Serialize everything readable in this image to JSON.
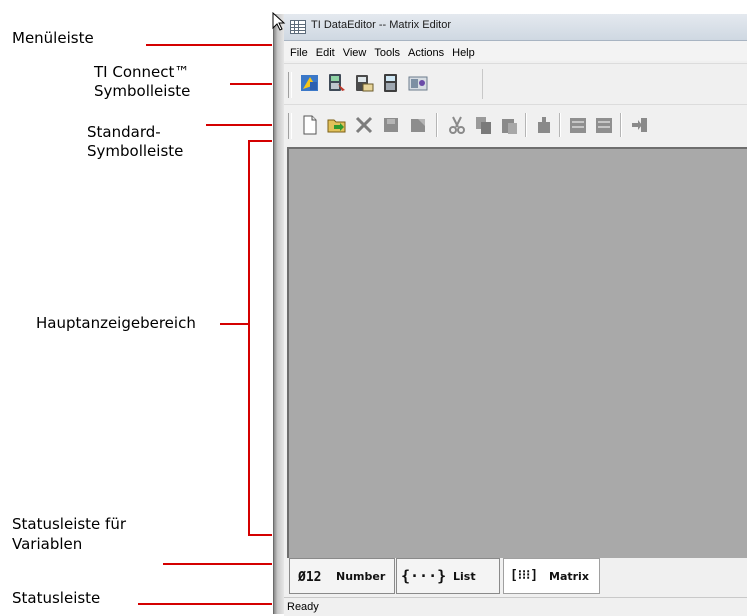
{
  "annotations": {
    "menubar": "Menüleiste",
    "ti_connect_line1": "TI Connect™",
    "ti_connect_line2": "Symbolleiste",
    "standard_line1": "Standard-",
    "standard_line2": "Symbolleiste",
    "main_area": "Hauptanzeigebereich",
    "var_status_line1": "Statusleiste für",
    "var_status_line2": "Variablen",
    "statusbar": "Statusleiste"
  },
  "window": {
    "title": "TI DataEditor -- Matrix Editor"
  },
  "menu": [
    "File",
    "Edit",
    "View",
    "Tools",
    "Actions",
    "Help"
  ],
  "ti_connect_toolbar": {
    "icons": [
      "ti-connect-explorer-icon",
      "device-info-icon",
      "screen-capture-icon",
      "calculator-backup-icon",
      "device-explorer-icon"
    ]
  },
  "standard_toolbar": {
    "icons": [
      "new-icon",
      "open-icon",
      "delete-icon",
      "save-icon",
      "save-as-icon",
      "cut-icon",
      "copy-icon",
      "paste-icon",
      "send-icon",
      "insert-row-icon",
      "insert-column-icon",
      "exit-icon"
    ]
  },
  "variable_bar": {
    "number": {
      "icon": "Ø12",
      "label": "Number"
    },
    "list": {
      "icon": "{···}",
      "label": "List"
    },
    "matrix": {
      "icon": "[⁝⁝⁝]",
      "label": "Matrix",
      "selected": true
    }
  },
  "status": {
    "text": "Ready"
  }
}
